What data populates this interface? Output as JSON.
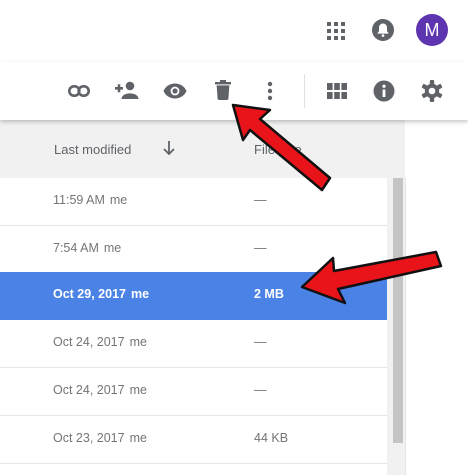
{
  "account": {
    "avatar_letter": "M",
    "avatar_color": "#5e35b1"
  },
  "top_icons": [
    "apps-grid-icon",
    "notifications-bell-icon",
    "account-avatar"
  ],
  "toolbar": {
    "actions": [
      "get-link-icon",
      "share-add-person-icon",
      "preview-eye-icon",
      "trash-delete-icon",
      "more-vertical-icon"
    ],
    "view": [
      "grid-view-icon",
      "details-info-icon",
      "settings-gear-icon"
    ]
  },
  "list": {
    "headers": {
      "last_modified": "Last modified",
      "file_size": "File size"
    },
    "sort": "descending",
    "rows": [
      {
        "modified": "11:59 AM",
        "owner": "me",
        "size": "—"
      },
      {
        "modified": "7:54 AM",
        "owner": "me",
        "size": "—"
      },
      {
        "modified": "Oct 29, 2017",
        "owner": "me",
        "size": "2 MB",
        "selected": true
      },
      {
        "modified": "Oct 24, 2017",
        "owner": "me",
        "size": "—"
      },
      {
        "modified": "Oct 24, 2017",
        "owner": "me",
        "size": "—"
      },
      {
        "modified": "Oct 23, 2017",
        "owner": "me",
        "size": "44 KB"
      }
    ]
  },
  "colors": {
    "selection": "#4a82e5",
    "annotation_arrow": "#e8141a"
  }
}
